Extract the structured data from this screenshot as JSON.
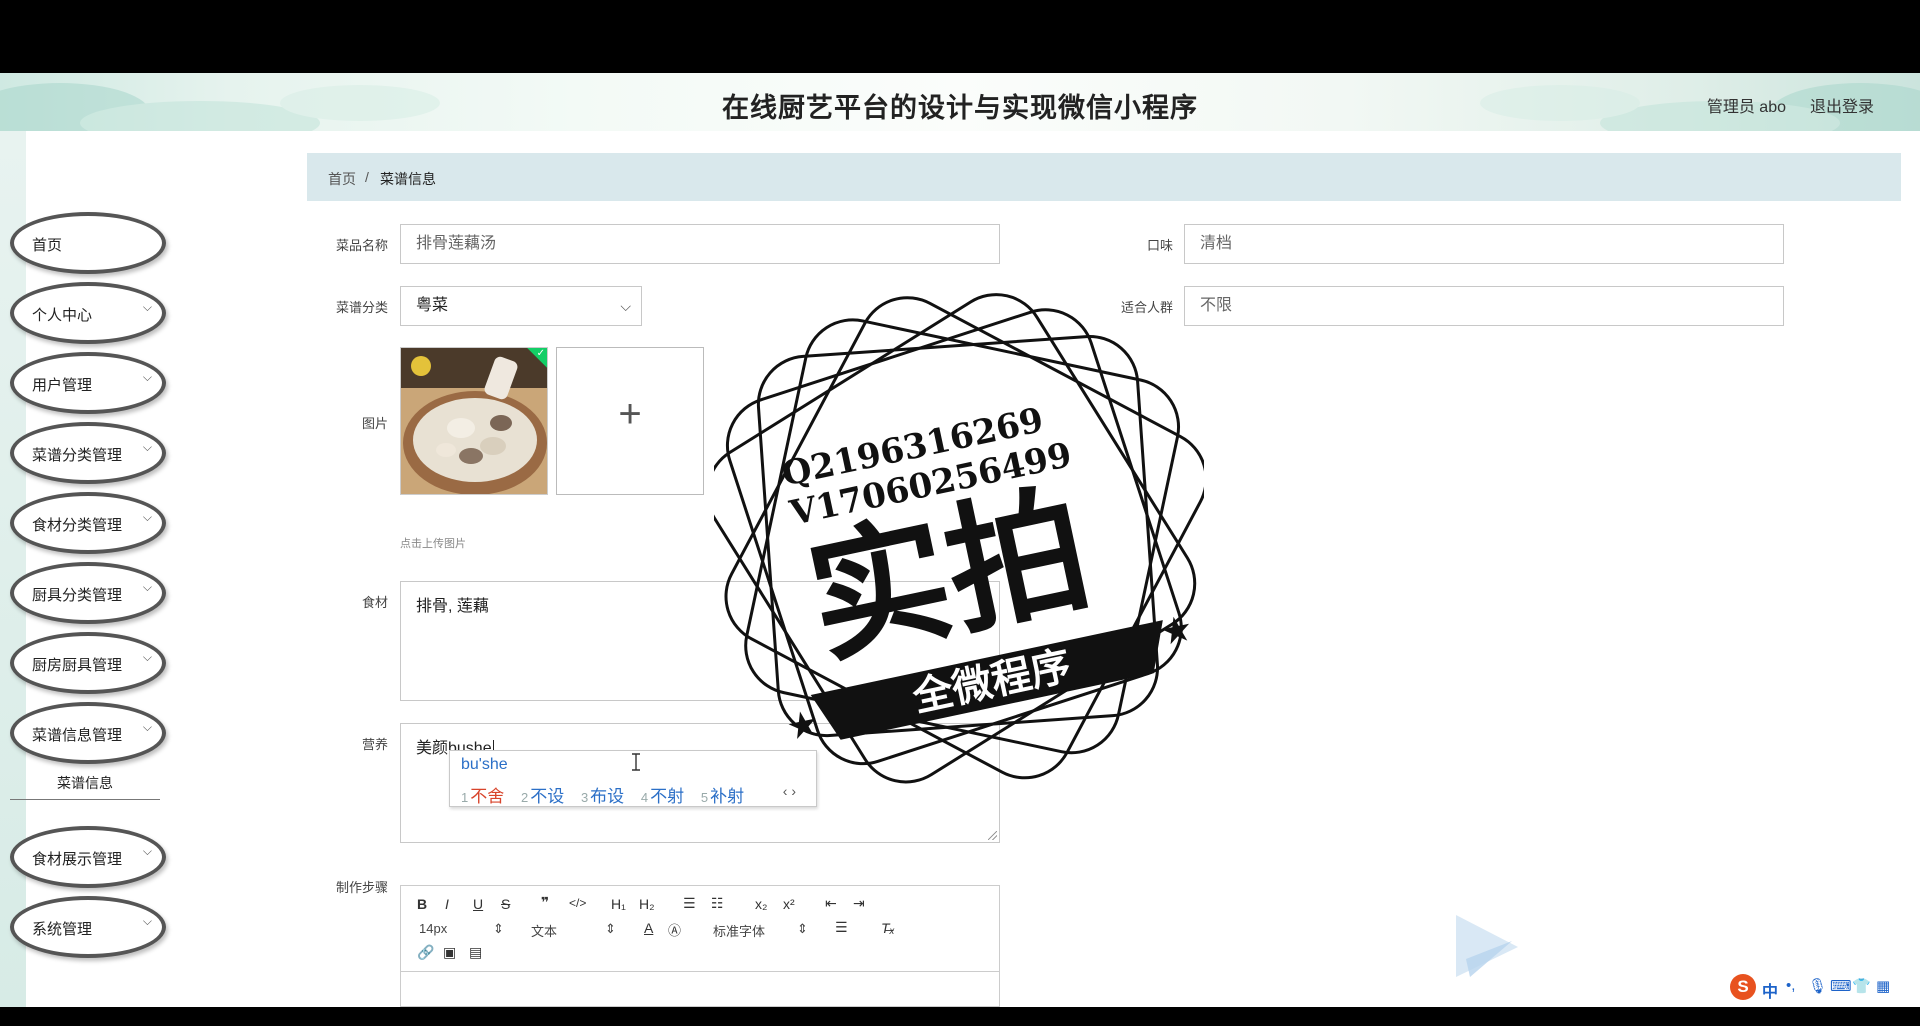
{
  "header": {
    "title": "在线厨艺平台的设计与实现微信小程序",
    "user": "管理员 abo",
    "logout": "退出登录"
  },
  "sidebar": {
    "items": [
      {
        "label": "首页",
        "has_arrow": false
      },
      {
        "label": "个人中心",
        "has_arrow": true
      },
      {
        "label": "用户管理",
        "has_arrow": true
      },
      {
        "label": "菜谱分类管理",
        "has_arrow": true
      },
      {
        "label": "食材分类管理",
        "has_arrow": true
      },
      {
        "label": "厨具分类管理",
        "has_arrow": true
      },
      {
        "label": "厨房厨具管理",
        "has_arrow": true
      },
      {
        "label": "菜谱信息管理",
        "has_arrow": true
      },
      {
        "label": "食材展示管理",
        "has_arrow": true
      },
      {
        "label": "系统管理",
        "has_arrow": true
      }
    ],
    "sub_item": "菜谱信息"
  },
  "breadcrumb": {
    "home": "首页",
    "separator": "/",
    "current": "菜谱信息"
  },
  "form": {
    "dish_name": {
      "label": "菜品名称",
      "value": "排骨莲藕汤"
    },
    "taste": {
      "label": "口味",
      "value": "清档"
    },
    "category": {
      "label": "菜谱分类",
      "value": "粤菜"
    },
    "audience": {
      "label": "适合人群",
      "value": "不限"
    },
    "image": {
      "label": "图片",
      "hint": "点击上传图片"
    },
    "ingredients": {
      "label": "食材",
      "value": "排骨, 莲藕"
    },
    "nutrition": {
      "label": "营养",
      "value": "美颜bushe"
    },
    "steps": {
      "label": "制作步骤"
    }
  },
  "ime": {
    "composition": "bu'she",
    "candidates": [
      {
        "num": "1",
        "text": "不舍"
      },
      {
        "num": "2",
        "text": "不设"
      },
      {
        "num": "3",
        "text": "布设"
      },
      {
        "num": "4",
        "text": "不射"
      },
      {
        "num": "5",
        "text": "补射"
      }
    ],
    "nav": "‹ ›"
  },
  "editor": {
    "font_size": "14px",
    "format": "文本",
    "font_family": "标准字体"
  },
  "watermark": {
    "line1": "Q2196316269",
    "line2": "V17060256499",
    "main": "实拍",
    "banner": "全微程序"
  },
  "tray": {
    "ime_mode": "中"
  },
  "colors": {
    "breadcrumb_bg": "#d9e8ec",
    "ime_accent": "#2b6fc7",
    "ime_first": "#d8442b",
    "upload_success": "#13ce66"
  }
}
